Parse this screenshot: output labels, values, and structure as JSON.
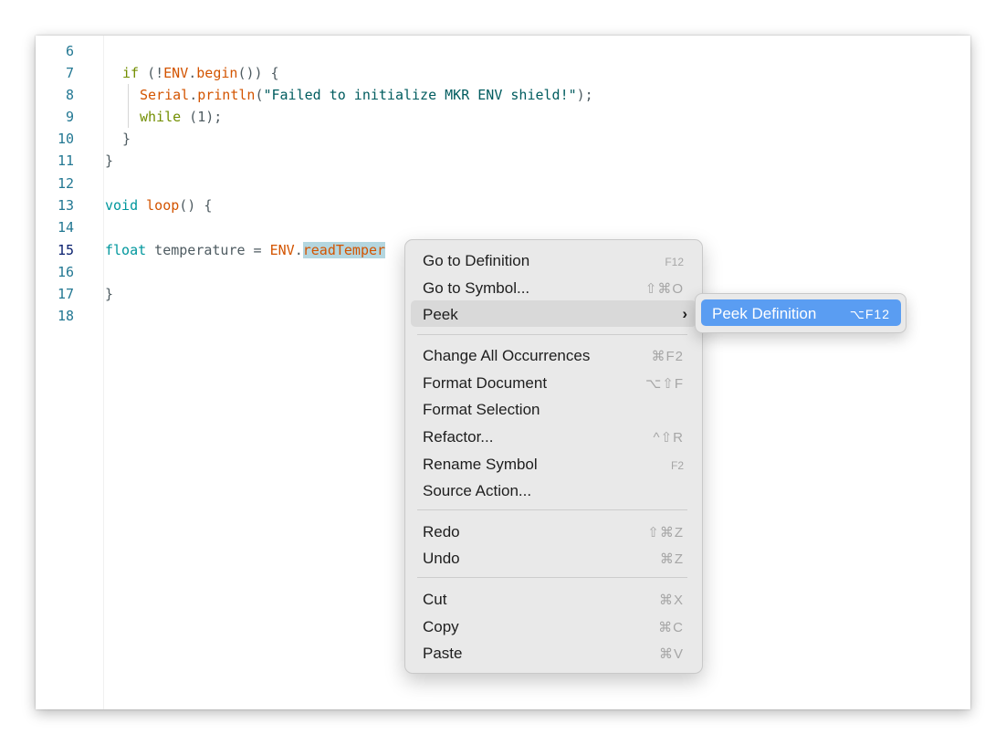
{
  "editor": {
    "lines": [
      {
        "num": "6"
      },
      {
        "num": "7",
        "tokens": {
          "t0": "if",
          "t1": " (!",
          "t2": "ENV",
          "t3": ".",
          "t4": "begin",
          "t5": "()) {"
        }
      },
      {
        "num": "8",
        "tokens": {
          "t0": "Serial",
          "t1": ".",
          "t2": "println",
          "t3": "(",
          "t4": "\"Failed to initialize MKR ENV shield!\"",
          "t5": ");"
        }
      },
      {
        "num": "9",
        "tokens": {
          "t0": "while",
          "t1": " (1);"
        }
      },
      {
        "num": "10",
        "tokens": {
          "t0": "}"
        }
      },
      {
        "num": "11",
        "tokens": {
          "t0": "}"
        }
      },
      {
        "num": "12"
      },
      {
        "num": "13",
        "tokens": {
          "t0": "void",
          "t1": " ",
          "t2": "loop",
          "t3": "() {"
        }
      },
      {
        "num": "14"
      },
      {
        "num": "15",
        "tokens": {
          "t0": "float",
          "t1": " temperature = ",
          "t2": "ENV",
          "t3": ".",
          "t4": "readTemper"
        }
      },
      {
        "num": "16"
      },
      {
        "num": "17",
        "tokens": {
          "t0": "}"
        }
      },
      {
        "num": "18"
      }
    ]
  },
  "context_menu": {
    "items": [
      {
        "label": "Go to Definition",
        "shortcut": "F12"
      },
      {
        "label": "Go to Symbol...",
        "shortcut": "⇧⌘O"
      },
      {
        "label": "Peek",
        "shortcut": "›"
      },
      {
        "label": "Change All Occurrences",
        "shortcut": "⌘F2"
      },
      {
        "label": "Format Document",
        "shortcut": "⌥⇧F"
      },
      {
        "label": "Format Selection",
        "shortcut": ""
      },
      {
        "label": "Refactor...",
        "shortcut": "^⇧R"
      },
      {
        "label": "Rename Symbol",
        "shortcut": "F2"
      },
      {
        "label": "Source Action...",
        "shortcut": ""
      },
      {
        "label": "Redo",
        "shortcut": "⇧⌘Z"
      },
      {
        "label": "Undo",
        "shortcut": "⌘Z"
      },
      {
        "label": "Cut",
        "shortcut": "⌘X"
      },
      {
        "label": "Copy",
        "shortcut": "⌘C"
      },
      {
        "label": "Paste",
        "shortcut": "⌘V"
      }
    ]
  },
  "submenu": {
    "items": [
      {
        "label": "Peek Definition",
        "shortcut": "⌥F12"
      }
    ]
  },
  "colors": {
    "accent": "#5a9df2",
    "selection": "#b4d6df",
    "keyword": "#00979d",
    "function": "#d35400",
    "line_number": "#237893"
  }
}
